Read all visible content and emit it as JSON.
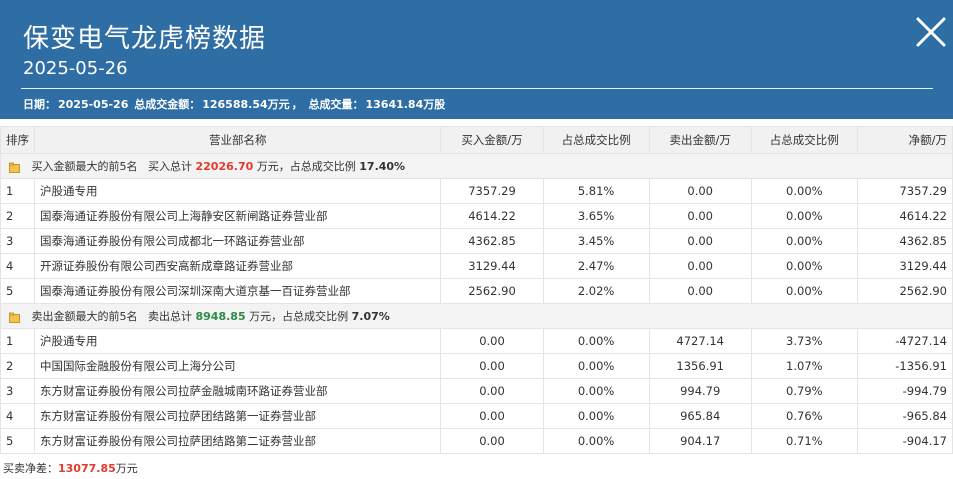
{
  "header": {
    "title": "保变电气龙虎榜数据",
    "date": "2025-05-26",
    "summary_date_label": "日期：",
    "summary_date": "2025-05-26",
    "summary_amount_label": "总成交金额：",
    "summary_amount": "126588.54万元",
    "summary_volume_label": "总成交量：",
    "summary_volume": "13641.84万股",
    "close_icon": "close-icon"
  },
  "table": {
    "columns": [
      "排序",
      "营业部名称",
      "买入金额/万",
      "占总成交比例",
      "卖出金额/万",
      "占总成交比例",
      "净额/万"
    ],
    "buy_group": {
      "icon": "folder-icon",
      "label": "买入金额最大的前5名",
      "total_label": "买入总计",
      "total_value": "22026.70",
      "total_unit": "万元，占总成交比例",
      "ratio": "17.40%"
    },
    "buy_rows": [
      {
        "rank": "1",
        "name": "沪股通专用",
        "buy": "7357.29",
        "buy_pct": "5.81%",
        "sell": "0.00",
        "sell_pct": "0.00%",
        "net": "7357.29"
      },
      {
        "rank": "2",
        "name": "国泰海通证券股份有限公司上海静安区新闸路证券营业部",
        "buy": "4614.22",
        "buy_pct": "3.65%",
        "sell": "0.00",
        "sell_pct": "0.00%",
        "net": "4614.22"
      },
      {
        "rank": "3",
        "name": "国泰海通证券股份有限公司成都北一环路证券营业部",
        "buy": "4362.85",
        "buy_pct": "3.45%",
        "sell": "0.00",
        "sell_pct": "0.00%",
        "net": "4362.85"
      },
      {
        "rank": "4",
        "name": "开源证券股份有限公司西安高新成章路证券营业部",
        "buy": "3129.44",
        "buy_pct": "2.47%",
        "sell": "0.00",
        "sell_pct": "0.00%",
        "net": "3129.44"
      },
      {
        "rank": "5",
        "name": "国泰海通证券股份有限公司深圳深南大道京基一百证券营业部",
        "buy": "2562.90",
        "buy_pct": "2.02%",
        "sell": "0.00",
        "sell_pct": "0.00%",
        "net": "2562.90"
      }
    ],
    "sell_group": {
      "icon": "folder-icon",
      "label": "卖出金额最大的前5名",
      "total_label": "卖出总计",
      "total_value": "8948.85",
      "total_unit": "万元，占总成交比例",
      "ratio": "7.07%"
    },
    "sell_rows": [
      {
        "rank": "1",
        "name": "沪股通专用",
        "buy": "0.00",
        "buy_pct": "0.00%",
        "sell": "4727.14",
        "sell_pct": "3.73%",
        "net": "-4727.14"
      },
      {
        "rank": "2",
        "name": "中国国际金融股份有限公司上海分公司",
        "buy": "0.00",
        "buy_pct": "0.00%",
        "sell": "1356.91",
        "sell_pct": "1.07%",
        "net": "-1356.91"
      },
      {
        "rank": "3",
        "name": "东方财富证券股份有限公司拉萨金融城南环路证券营业部",
        "buy": "0.00",
        "buy_pct": "0.00%",
        "sell": "994.79",
        "sell_pct": "0.79%",
        "net": "-994.79"
      },
      {
        "rank": "4",
        "name": "东方财富证券股份有限公司拉萨团结路第一证券营业部",
        "buy": "0.00",
        "buy_pct": "0.00%",
        "sell": "965.84",
        "sell_pct": "0.76%",
        "net": "-965.84"
      },
      {
        "rank": "5",
        "name": "东方财富证券股份有限公司拉萨团结路第二证券营业部",
        "buy": "0.00",
        "buy_pct": "0.00%",
        "sell": "904.17",
        "sell_pct": "0.71%",
        "net": "-904.17"
      }
    ]
  },
  "footer": {
    "label": "买卖净差：",
    "value": "13077.85",
    "unit": "万元"
  },
  "colors": {
    "header_bg": "#2f6ea5",
    "positive": "#e23b2e",
    "negative": "#2e8b45",
    "link": "#1a63a8"
  }
}
